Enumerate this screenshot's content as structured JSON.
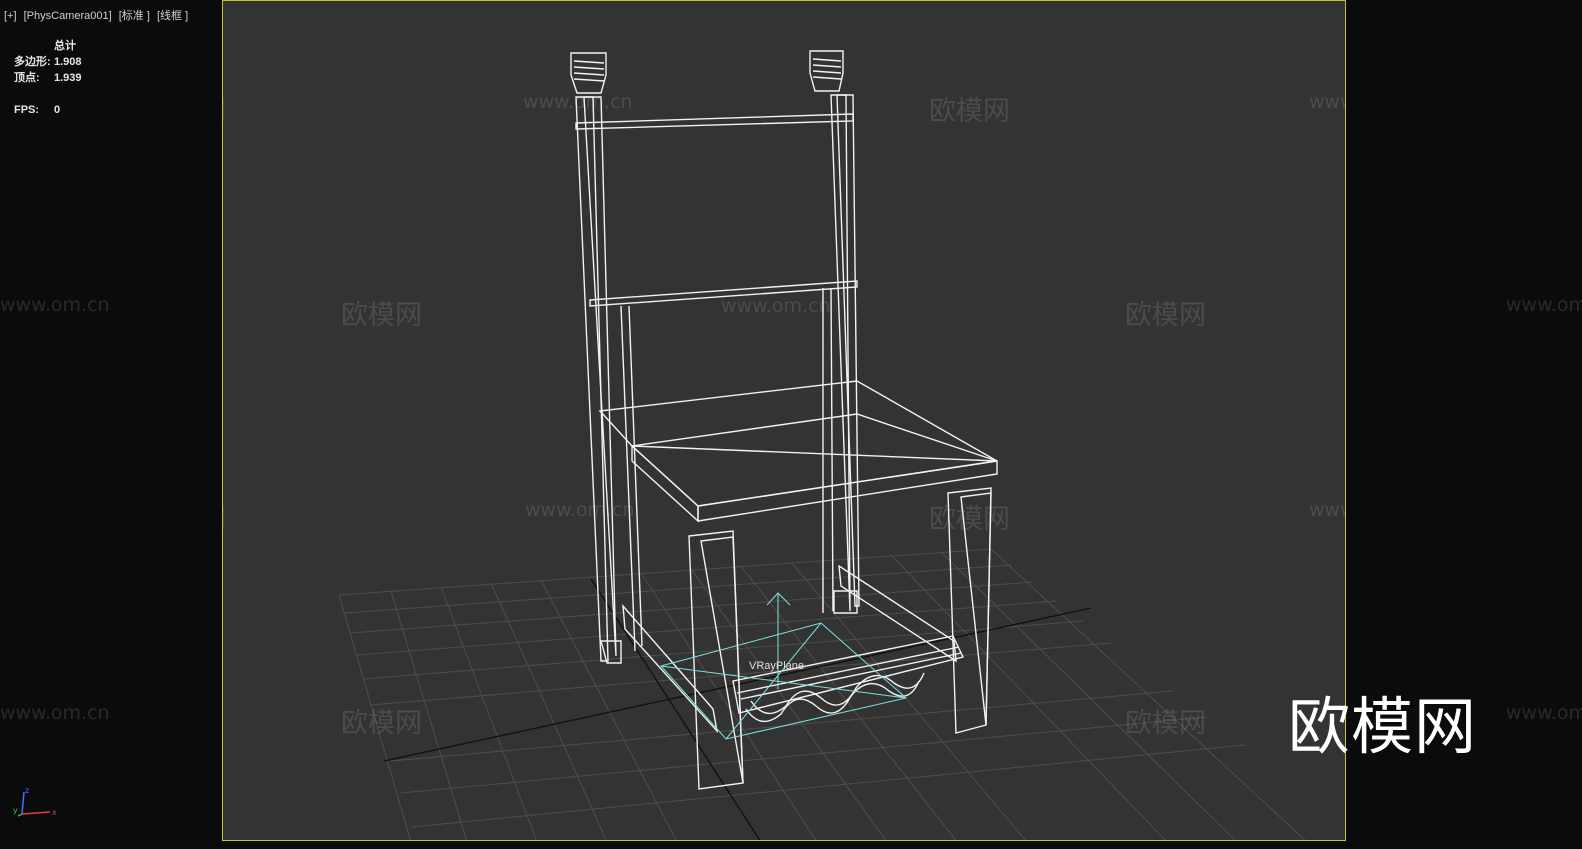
{
  "viewport_label": {
    "menu": "[+]",
    "camera": "[PhysCamera001]",
    "shading": "[标准 ]",
    "mode": "[线框 ]"
  },
  "stats": {
    "title": "总计",
    "polygons_label": "多边形:",
    "polygons_value": "1.908",
    "vertices_label": "顶点:",
    "vertices_value": "1.939",
    "fps_label": "FPS:",
    "fps_value": "0"
  },
  "axis": {
    "x": "x",
    "y": "y",
    "z": "z"
  },
  "object_label": "VRayPlane",
  "watermark": {
    "brand": "欧模网",
    "url": "www.om.cn"
  },
  "colors": {
    "viewport_border": "#c9c43a",
    "viewport_bg": "#333333",
    "grid": "#4a4a4a",
    "wireframe": "#f2f2f2",
    "plane": "#7fe0e0",
    "axis_x": "#e04040",
    "axis_y": "#40c040",
    "axis_z": "#4a70ff"
  }
}
